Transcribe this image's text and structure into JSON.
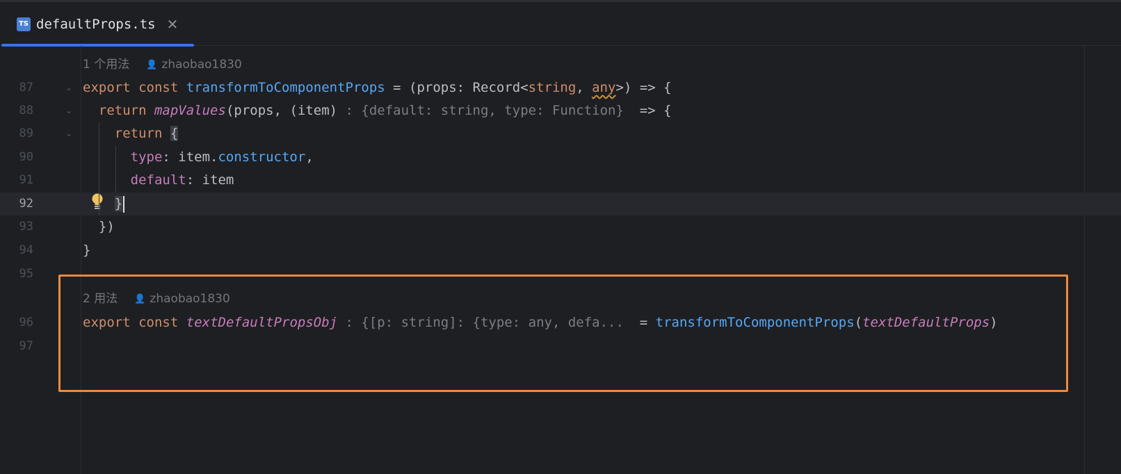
{
  "tab": {
    "icon_text": "TS",
    "filename": "defaultProps.ts",
    "close_glyph": "✕"
  },
  "usage_1": {
    "count": "1 个用法",
    "author": "zhaobao1830"
  },
  "usage_2": {
    "count": "2 用法",
    "author": "zhaobao1830"
  },
  "lines": {
    "l87": "87",
    "l88": "88",
    "l89": "89",
    "l90": "90",
    "l91": "91",
    "l92": "92",
    "l93": "93",
    "l94": "94",
    "l95": "95",
    "l96": "96",
    "l97": "97"
  },
  "code": {
    "export": "export",
    "const": "const",
    "return": "return",
    "transform_fn": "transformToComponentProps",
    "sig_a": " = (props: Record<",
    "string_t": "string",
    "comma": ", ",
    "any_t": "any",
    "sig_b": ">) => {",
    "map_values": "mapValues",
    "map_args": "(props, (item)",
    "hint_item": " : {default: string, type: Function} ",
    "arrow_open": " => {",
    "open_brace": "{",
    "type_key": "type",
    "type_val": ": item.",
    "constructor": "constructor",
    "trailing_comma": ",",
    "default_key": "default",
    "default_val": ": item",
    "close_brace": "}",
    "close_paren": "})",
    "close_fn": "}",
    "obj_name": "textDefaultPropsObj",
    "hint_obj": " : {[p: string]: {type: any, defa... ",
    "assign": " = ",
    "open_paren": "(",
    "arg_name": "textDefaultProps",
    "end_paren": ")"
  },
  "colors": {
    "keyword": "#cf8e6d",
    "function": "#56a8f5",
    "property": "#c77dbb",
    "highlight_box": "#ef8a3c",
    "tab_accent": "#3574f0"
  },
  "icons": {
    "file_type": "typescript-icon",
    "close": "close-icon",
    "fold": "fold-chevron-icon",
    "user": "user-icon",
    "intention": "lightbulb-icon"
  }
}
